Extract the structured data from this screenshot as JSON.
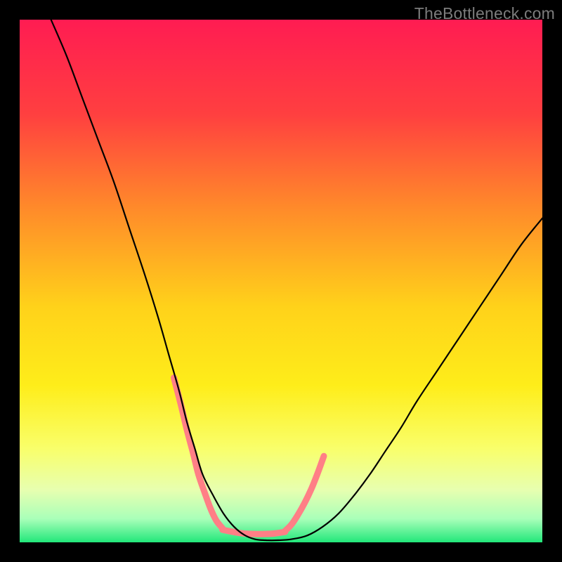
{
  "watermark": "TheBottleneck.com",
  "chart_data": {
    "type": "line",
    "title": "",
    "xlabel": "",
    "ylabel": "",
    "xlim": [
      0,
      100
    ],
    "ylim": [
      0,
      100
    ],
    "grid": false,
    "legend": null,
    "gradient_stops": [
      {
        "offset": 0.0,
        "color": "#ff1c52"
      },
      {
        "offset": 0.18,
        "color": "#ff3f40"
      },
      {
        "offset": 0.36,
        "color": "#ff8a2a"
      },
      {
        "offset": 0.55,
        "color": "#ffd21a"
      },
      {
        "offset": 0.7,
        "color": "#feed1a"
      },
      {
        "offset": 0.82,
        "color": "#f9ff6a"
      },
      {
        "offset": 0.9,
        "color": "#e7ffb0"
      },
      {
        "offset": 0.955,
        "color": "#a9ffb9"
      },
      {
        "offset": 1.0,
        "color": "#22e77a"
      }
    ],
    "series": [
      {
        "name": "bottleneck-curve",
        "color": "#000000",
        "stroke_width": 2.2,
        "x": [
          6,
          9,
          12,
          15,
          18,
          21,
          24,
          26.5,
          28.5,
          30.5,
          32,
          33.5,
          35,
          37,
          39,
          41,
          43,
          45,
          47,
          49.5,
          52,
          55,
          58,
          61,
          64,
          67,
          70,
          73,
          76,
          80,
          84,
          88,
          92,
          96,
          100
        ],
        "values": [
          100,
          93,
          85,
          77,
          69,
          60,
          51,
          43,
          36,
          29,
          23,
          18,
          13,
          9,
          5.5,
          3,
          1.4,
          0.6,
          0.4,
          0.4,
          0.6,
          1.3,
          3,
          5.5,
          9,
          13,
          17.5,
          22,
          27,
          33,
          39,
          45,
          51,
          57,
          62
        ]
      }
    ],
    "marks": {
      "name": "pink-marks",
      "color": "#ff7f86",
      "stroke_width": 9,
      "segments": [
        {
          "x": [
            29.5,
            30.8,
            32.0,
            33.2,
            34.2,
            35.4,
            36.5,
            37.6,
            38.8
          ],
          "y": [
            31.5,
            26.5,
            21.5,
            17.0,
            13.0,
            9.5,
            6.5,
            4.2,
            2.7
          ]
        },
        {
          "x": [
            38.8,
            40.8,
            42.8,
            44.8,
            46.8,
            48.8,
            50.8
          ],
          "y": [
            2.4,
            2.0,
            1.7,
            1.6,
            1.6,
            1.7,
            2.0
          ]
        },
        {
          "x": [
            50.8,
            52.0,
            53.2,
            54.5,
            55.8,
            57.0,
            58.2
          ],
          "y": [
            2.2,
            3.4,
            5.2,
            7.5,
            10.2,
            13.2,
            16.5
          ]
        }
      ]
    }
  }
}
